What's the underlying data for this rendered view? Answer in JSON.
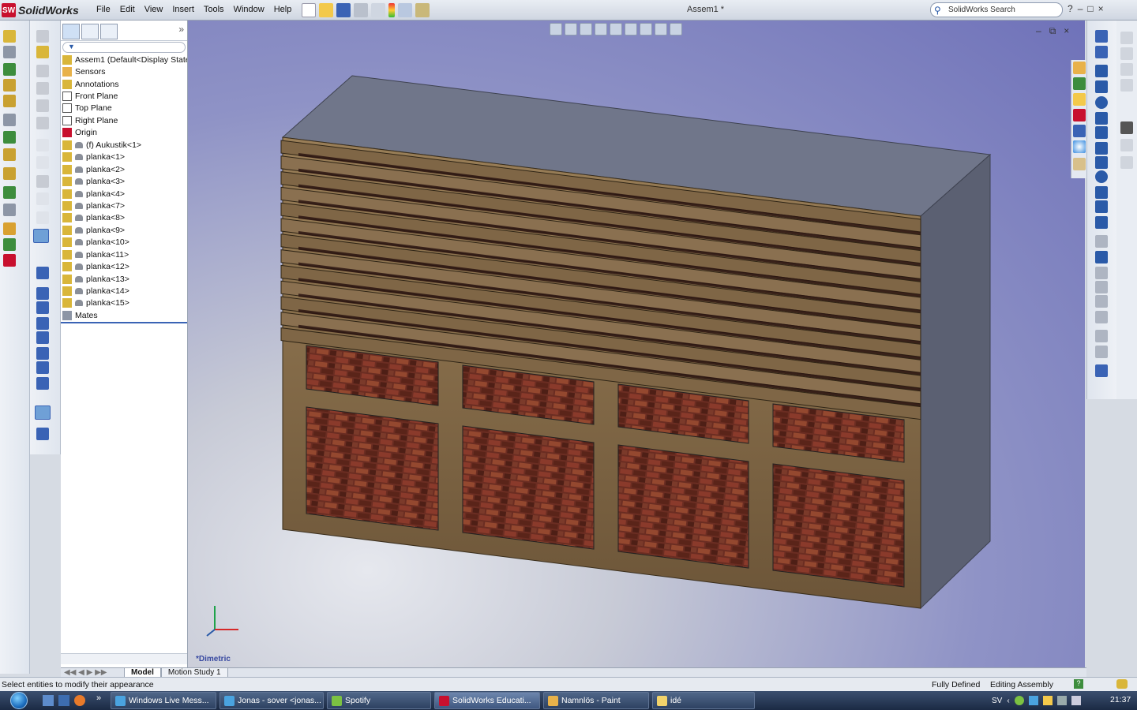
{
  "app": {
    "name": "SolidWorks",
    "logo_mark": "SW",
    "document_title": "Assem1 *",
    "menus": [
      "File",
      "Edit",
      "View",
      "Insert",
      "Tools",
      "Window",
      "Help"
    ],
    "search_placeholder": "SolidWorks Search",
    "window_controls": [
      "?",
      "–",
      "□",
      "×"
    ]
  },
  "feature_tree": {
    "filter_icon": "funnel-icon",
    "items": [
      {
        "label": "Assem1  (Default<Display State-",
        "icon": "assembly-icon",
        "indent": 0
      },
      {
        "label": "Sensors",
        "icon": "sensor-icon",
        "indent": 0
      },
      {
        "label": "Annotations",
        "icon": "annotation-icon",
        "indent": 0
      },
      {
        "label": "Front Plane",
        "icon": "plane-icon",
        "indent": 0
      },
      {
        "label": "Top Plane",
        "icon": "plane-icon",
        "indent": 0
      },
      {
        "label": "Right Plane",
        "icon": "plane-icon",
        "indent": 0
      },
      {
        "label": "Origin",
        "icon": "origin-icon",
        "indent": 0
      },
      {
        "label": "(f) Aukustik<1>",
        "icon": "part-icon",
        "indent": 1
      },
      {
        "label": "planka<1>",
        "icon": "part-icon",
        "indent": 1
      },
      {
        "label": "planka<2>",
        "icon": "part-icon",
        "indent": 1
      },
      {
        "label": "planka<3>",
        "icon": "part-icon",
        "indent": 1
      },
      {
        "label": "planka<4>",
        "icon": "part-icon",
        "indent": 1
      },
      {
        "label": "planka<7>",
        "icon": "part-icon",
        "indent": 1
      },
      {
        "label": "planka<8>",
        "icon": "part-icon",
        "indent": 1
      },
      {
        "label": "planka<9>",
        "icon": "part-icon",
        "indent": 1
      },
      {
        "label": "planka<10>",
        "icon": "part-icon",
        "indent": 1
      },
      {
        "label": "planka<11>",
        "icon": "part-icon",
        "indent": 1
      },
      {
        "label": "planka<12>",
        "icon": "part-icon",
        "indent": 1
      },
      {
        "label": "planka<13>",
        "icon": "part-icon",
        "indent": 1
      },
      {
        "label": "planka<14>",
        "icon": "part-icon",
        "indent": 1
      },
      {
        "label": "planka<15>",
        "icon": "part-icon",
        "indent": 1
      },
      {
        "label": "Mates",
        "icon": "mates-icon",
        "indent": 0
      }
    ]
  },
  "viewport": {
    "view_name": "*Dimetric"
  },
  "bottom_tabs": [
    "Model",
    "Motion Study 1"
  ],
  "status": {
    "message": "Select entities to modify their appearance",
    "definition": "Fully Defined",
    "mode": "Editing Assembly",
    "help": "?"
  },
  "taskbar": {
    "items": [
      {
        "label": "Windows Live Mess...",
        "icon": "messenger-icon",
        "color": "#4aa3df"
      },
      {
        "label": "Jonas - sover <jonas...",
        "icon": "messenger-chat-icon",
        "color": "#4aa3df"
      },
      {
        "label": "Spotify",
        "icon": "spotify-icon",
        "color": "#7cc242"
      },
      {
        "label": "SolidWorks Educati...",
        "icon": "solidworks-icon",
        "color": "#c8102e"
      },
      {
        "label": "Namnlös - Paint",
        "icon": "paint-icon",
        "color": "#e8b24a"
      },
      {
        "label": "idé",
        "icon": "folder-icon",
        "color": "#f2d36b"
      }
    ],
    "language": "SV",
    "clock": "21:37"
  },
  "colors": {
    "wood": "#7a6240",
    "wood_light": "#8d7350",
    "box_top": "#6f7584",
    "box_side": "#5c6170",
    "brick": "#6b2d22",
    "accent": "#3748a0"
  }
}
